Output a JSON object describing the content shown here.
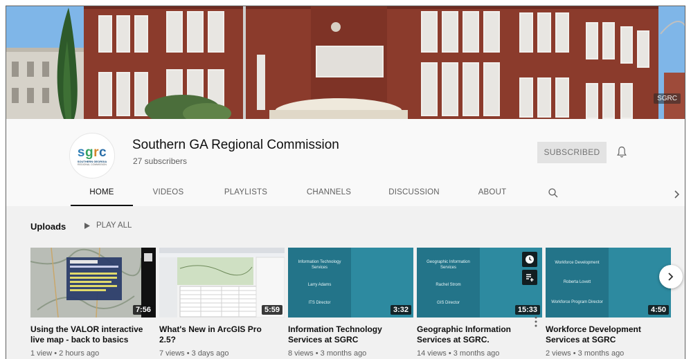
{
  "banner": {
    "watermark": "SGRC"
  },
  "channel": {
    "name": "Southern GA Regional Commission",
    "subscribers": "27 subscribers",
    "logo": {
      "letters": [
        "s",
        "g",
        "r",
        "c"
      ],
      "line1": "SOUTHERN GEORGIA",
      "line2": "REGIONAL COMMISSION"
    },
    "subscribe_label": "SUBSCRIBED"
  },
  "tabs": [
    {
      "label": "HOME",
      "active": true
    },
    {
      "label": "VIDEOS",
      "active": false
    },
    {
      "label": "PLAYLISTS",
      "active": false
    },
    {
      "label": "CHANNELS",
      "active": false
    },
    {
      "label": "DISCUSSION",
      "active": false
    },
    {
      "label": "ABOUT",
      "active": false
    }
  ],
  "uploads": {
    "label": "Uploads",
    "play_all": "PLAY ALL",
    "videos": [
      {
        "title_line1": "Using the VALOR interactive",
        "title_line2": "live map - back to basics",
        "meta": "1 view • 2 hours ago",
        "duration": "7:56"
      },
      {
        "title_line1": "What's New in ArcGIS Pro",
        "title_line2": "2.5?",
        "meta": "7 views • 3 days ago",
        "duration": "5:59"
      },
      {
        "title_line1": "Information Technology",
        "title_line2": "Services at SGRC",
        "meta": "8 views • 3 months ago",
        "duration": "3:32",
        "slide": [
          "Information Technology Services",
          "Larry Adams",
          "ITS Director"
        ]
      },
      {
        "title_line1": "Geographic Information",
        "title_line2": "Services at SGRC.",
        "meta": "14 views • 3 months ago",
        "duration": "15:33",
        "slide": [
          "Geographic Information Services",
          "Rachel Strom",
          "GIS Director"
        ]
      },
      {
        "title_line1": "Workforce Development",
        "title_line2": "Services at SGRC",
        "meta": "2 views • 3 months ago",
        "duration": "4:50",
        "slide": [
          "Workforce Development",
          "Roberta Lovett",
          "Workforce Program Director"
        ]
      }
    ]
  },
  "colors": {
    "teal": "#2d8aa0",
    "teal_dark": "#237489",
    "banner_brick": "#8a3a2c",
    "sky": "#7ab2e6"
  }
}
